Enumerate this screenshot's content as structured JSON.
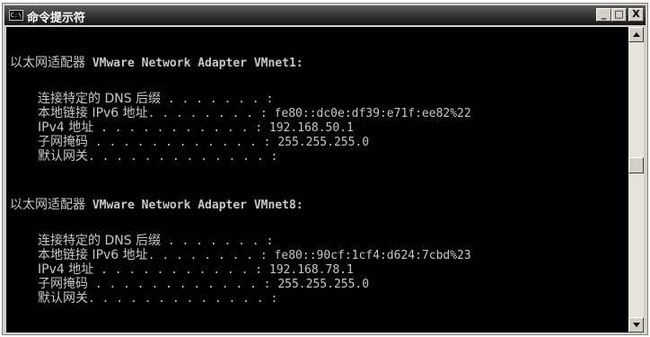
{
  "window": {
    "title": "命令提示符",
    "icon_label": "C:\\",
    "controls": {
      "minimize": "_",
      "maximize": "□",
      "close": "X"
    }
  },
  "console": {
    "adapters": [
      {
        "heading_prefix": "以太网适配器",
        "heading_name": " VMware Network Adapter VMnet1:",
        "fields": [
          {
            "label": "连接特定的 DNS 后缀",
            "dots": " . . . . . . . :",
            "value": ""
          },
          {
            "label": "本地链接 IPv6 地址",
            "dots": ". . . . . . . . :",
            "value": " fe80::dc0e:df39:e71f:ee82%22"
          },
          {
            "label": "IPv4 地址",
            "dots": " . . . . . . . . . . . :",
            "value": " 192.168.50.1"
          },
          {
            "label": "子网掩码",
            "dots": " . . . . . . . . . . . . :",
            "value": " 255.255.255.0"
          },
          {
            "label": "默认网关",
            "dots": ". . . . . . . . . . . . . :",
            "value": ""
          }
        ]
      },
      {
        "heading_prefix": "以太网适配器",
        "heading_name": " VMware Network Adapter VMnet8:",
        "fields": [
          {
            "label": "连接特定的 DNS 后缀",
            "dots": " . . . . . . . :",
            "value": ""
          },
          {
            "label": "本地链接 IPv6 地址",
            "dots": ". . . . . . . . :",
            "value": " fe80::90cf:1cf4:d624:7cbd%23"
          },
          {
            "label": "IPv4 地址",
            "dots": " . . . . . . . . . . . :",
            "value": " 192.168.78.1"
          },
          {
            "label": "子网掩码",
            "dots": " . . . . . . . . . . . . :",
            "value": " 255.255.255.0"
          },
          {
            "label": "默认网关",
            "dots": ". . . . . . . . . . . . . :",
            "value": ""
          }
        ]
      }
    ]
  },
  "colors": {
    "console_bg": "#000000",
    "console_text": "#c8c8c8",
    "titlebar": "#141414"
  }
}
